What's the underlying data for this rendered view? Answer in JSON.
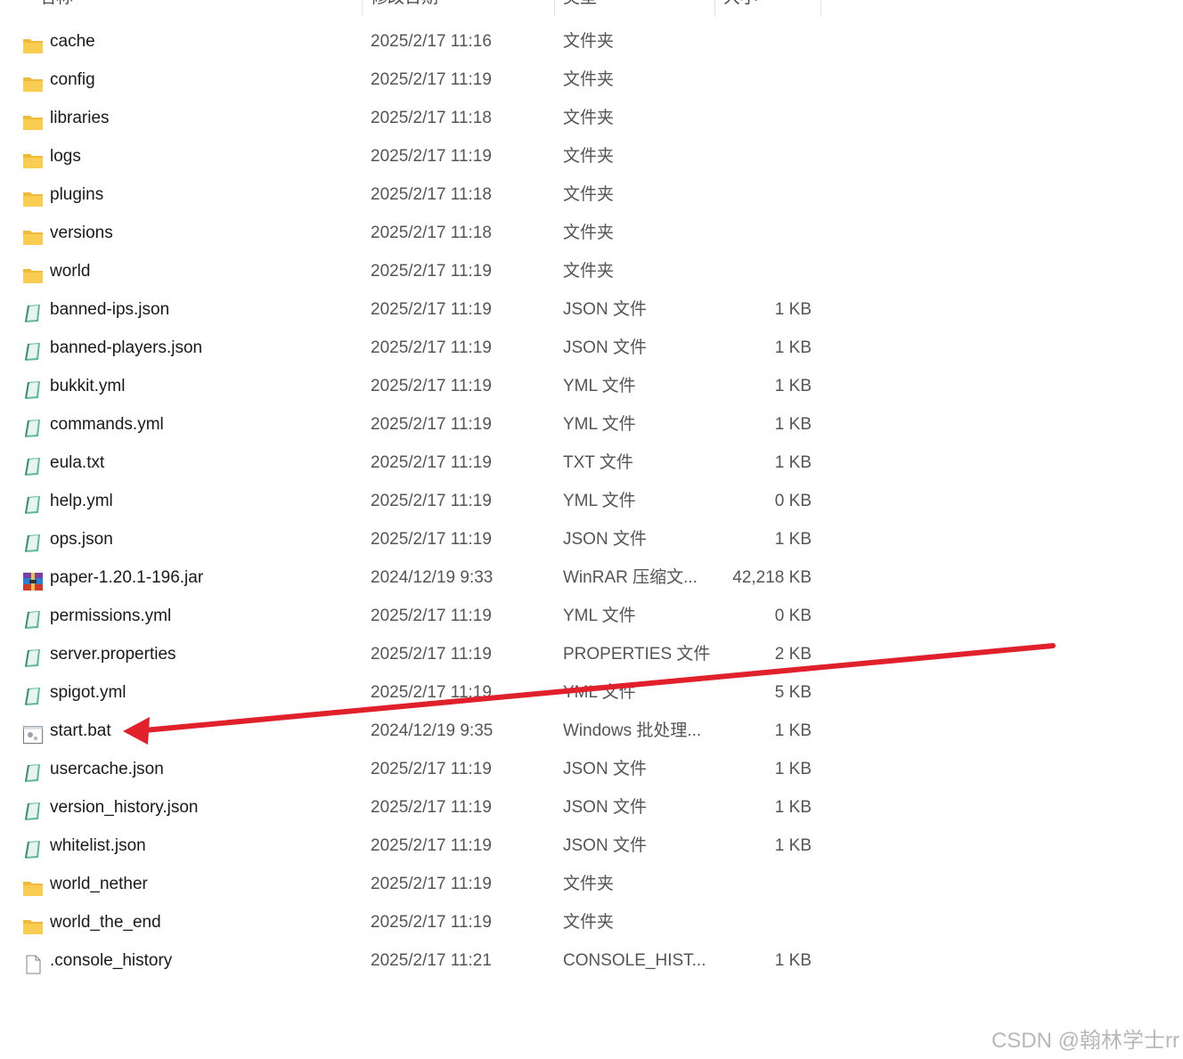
{
  "columns": {
    "name": "名称",
    "date": "修改日期",
    "type": "类型",
    "size": "大小"
  },
  "files": [
    {
      "name": "cache",
      "date": "2025/2/17 11:16",
      "type": "文件夹",
      "size": "",
      "icon": "folder-icon"
    },
    {
      "name": "config",
      "date": "2025/2/17 11:19",
      "type": "文件夹",
      "size": "",
      "icon": "folder-icon"
    },
    {
      "name": "libraries",
      "date": "2025/2/17 11:18",
      "type": "文件夹",
      "size": "",
      "icon": "folder-icon"
    },
    {
      "name": "logs",
      "date": "2025/2/17 11:19",
      "type": "文件夹",
      "size": "",
      "icon": "folder-icon"
    },
    {
      "name": "plugins",
      "date": "2025/2/17 11:18",
      "type": "文件夹",
      "size": "",
      "icon": "folder-icon"
    },
    {
      "name": "versions",
      "date": "2025/2/17 11:18",
      "type": "文件夹",
      "size": "",
      "icon": "folder-icon"
    },
    {
      "name": "world",
      "date": "2025/2/17 11:19",
      "type": "文件夹",
      "size": "",
      "icon": "folder-icon"
    },
    {
      "name": "banned-ips.json",
      "date": "2025/2/17 11:19",
      "type": "JSON 文件",
      "size": "1 KB",
      "icon": "text-file-icon"
    },
    {
      "name": "banned-players.json",
      "date": "2025/2/17 11:19",
      "type": "JSON 文件",
      "size": "1 KB",
      "icon": "text-file-icon"
    },
    {
      "name": "bukkit.yml",
      "date": "2025/2/17 11:19",
      "type": "YML 文件",
      "size": "1 KB",
      "icon": "text-file-icon"
    },
    {
      "name": "commands.yml",
      "date": "2025/2/17 11:19",
      "type": "YML 文件",
      "size": "1 KB",
      "icon": "text-file-icon"
    },
    {
      "name": "eula.txt",
      "date": "2025/2/17 11:19",
      "type": "TXT 文件",
      "size": "1 KB",
      "icon": "text-file-icon"
    },
    {
      "name": "help.yml",
      "date": "2025/2/17 11:19",
      "type": "YML 文件",
      "size": "0 KB",
      "icon": "text-file-icon"
    },
    {
      "name": "ops.json",
      "date": "2025/2/17 11:19",
      "type": "JSON 文件",
      "size": "1 KB",
      "icon": "text-file-icon"
    },
    {
      "name": "paper-1.20.1-196.jar",
      "date": "2024/12/19 9:33",
      "type": "WinRAR 压缩文...",
      "size": "42,218 KB",
      "icon": "winrar-archive-icon"
    },
    {
      "name": "permissions.yml",
      "date": "2025/2/17 11:19",
      "type": "YML 文件",
      "size": "0 KB",
      "icon": "text-file-icon"
    },
    {
      "name": "server.properties",
      "date": "2025/2/17 11:19",
      "type": "PROPERTIES 文件",
      "size": "2 KB",
      "icon": "text-file-icon"
    },
    {
      "name": "spigot.yml",
      "date": "2025/2/17 11:19",
      "type": "YML 文件",
      "size": "5 KB",
      "icon": "text-file-icon"
    },
    {
      "name": "start.bat",
      "date": "2024/12/19 9:35",
      "type": "Windows 批处理...",
      "size": "1 KB",
      "icon": "batch-file-icon"
    },
    {
      "name": "usercache.json",
      "date": "2025/2/17 11:19",
      "type": "JSON 文件",
      "size": "1 KB",
      "icon": "text-file-icon"
    },
    {
      "name": "version_history.json",
      "date": "2025/2/17 11:19",
      "type": "JSON 文件",
      "size": "1 KB",
      "icon": "text-file-icon"
    },
    {
      "name": "whitelist.json",
      "date": "2025/2/17 11:19",
      "type": "JSON 文件",
      "size": "1 KB",
      "icon": "text-file-icon"
    },
    {
      "name": "world_nether",
      "date": "2025/2/17 11:19",
      "type": "文件夹",
      "size": "",
      "icon": "folder-icon"
    },
    {
      "name": "world_the_end",
      "date": "2025/2/17 11:19",
      "type": "文件夹",
      "size": "",
      "icon": "folder-icon"
    },
    {
      "name": ".console_history",
      "date": "2025/2/17 11:21",
      "type": "CONSOLE_HIST...",
      "size": "1 KB",
      "icon": "blank-file-icon"
    }
  ],
  "annotation": {
    "arrow_color": "#e0202a",
    "icon": "red-arrow-icon"
  },
  "colors": {
    "folder": "#f7c948",
    "text_file": "#5fb89a",
    "selection_text": "#555555"
  },
  "watermark": "CSDN @翰林学士rr"
}
